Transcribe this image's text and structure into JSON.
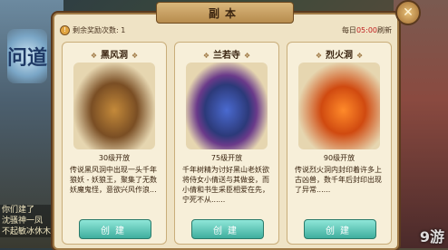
{
  "game": {
    "logo_text": "问道"
  },
  "panel": {
    "title": "副本",
    "close_label": "✕"
  },
  "info": {
    "remaining_label": "剩余奖励次数: 1",
    "reset_prefix": "每日",
    "reset_time": "05:00",
    "reset_suffix": "刷新"
  },
  "dungeons": [
    {
      "name": "黑风洞",
      "level": "30级开放",
      "description": "传说黑风洞中出现一头千年狼妖 - 妖狼王，聚集了无数妖魔鬼怪，意欲兴风作浪...",
      "button": "创建"
    },
    {
      "name": "兰若寺",
      "level": "75级开放",
      "description": "千年树精为讨好黑山老妖欲将侍女小倩送与其做妾，而小倩和书生采臣相爱在先，宁死不从......",
      "button": "创建"
    },
    {
      "name": "烈火洞",
      "level": "90级开放",
      "description": "传说烈火洞内封印着许多上古凶兽，数千年后封印出现了异常......",
      "button": "创建"
    }
  ],
  "chat_lines": [
    "你们建了",
    "沈骚神一凤",
    "不起敏冰休木"
  ],
  "watermark": "9游"
}
